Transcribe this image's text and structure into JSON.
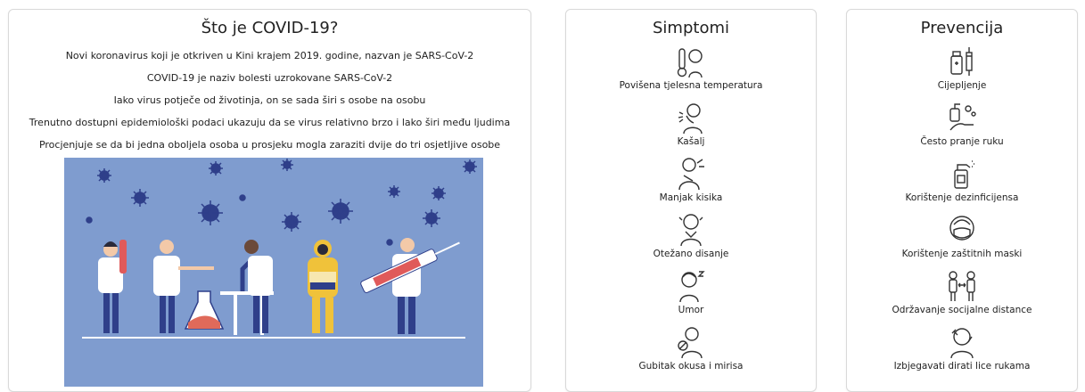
{
  "covid": {
    "title": "Što je COVID-19?",
    "paragraphs": [
      "Novi koronavirus koji je otkriven u Kini krajem 2019. godine, nazvan je SARS-CoV-2",
      "COVID-19 je naziv bolesti uzrokovane SARS-CoV-2",
      "Iako virus potječe od životinja, on se sada širi s osobe na osobu",
      "Trenutno dostupni epidemiološki podaci ukazuju da se virus relativno brzo i lako širi među ljudima",
      "Procjenjuje se da bi jedna oboljela osoba u prosjeku mogla zaraziti dvije do tri osjetljive osobe"
    ],
    "illustration_bg": "#7f9ccf"
  },
  "simptomi": {
    "title": "Simptomi",
    "items": [
      {
        "label": "Povišena tjelesna temperatura",
        "icon": "fever-thermometer-icon"
      },
      {
        "label": "Kašalj",
        "icon": "cough-icon"
      },
      {
        "label": "Manjak kisika",
        "icon": "lack-of-oxygen-icon"
      },
      {
        "label": "Otežano disanje",
        "icon": "difficult-breathing-icon"
      },
      {
        "label": "Umor",
        "icon": "fatigue-icon"
      },
      {
        "label": "Gubitak okusa i mirisa",
        "icon": "loss-of-taste-smell-icon"
      }
    ]
  },
  "prevencija": {
    "title": "Prevencija",
    "items": [
      {
        "label": "Cijepljenje",
        "icon": "vaccine-icon"
      },
      {
        "label": "Često pranje ruku",
        "icon": "hand-washing-icon"
      },
      {
        "label": "Korištenje dezinficijensa",
        "icon": "disinfectant-spray-icon"
      },
      {
        "label": "Korištenje zaštitnih maski",
        "icon": "face-mask-icon"
      },
      {
        "label": "Održavanje socijalne distance",
        "icon": "social-distance-icon"
      },
      {
        "label": "Izbjegavati dirati lice rukama",
        "icon": "no-face-touching-icon"
      }
    ]
  }
}
